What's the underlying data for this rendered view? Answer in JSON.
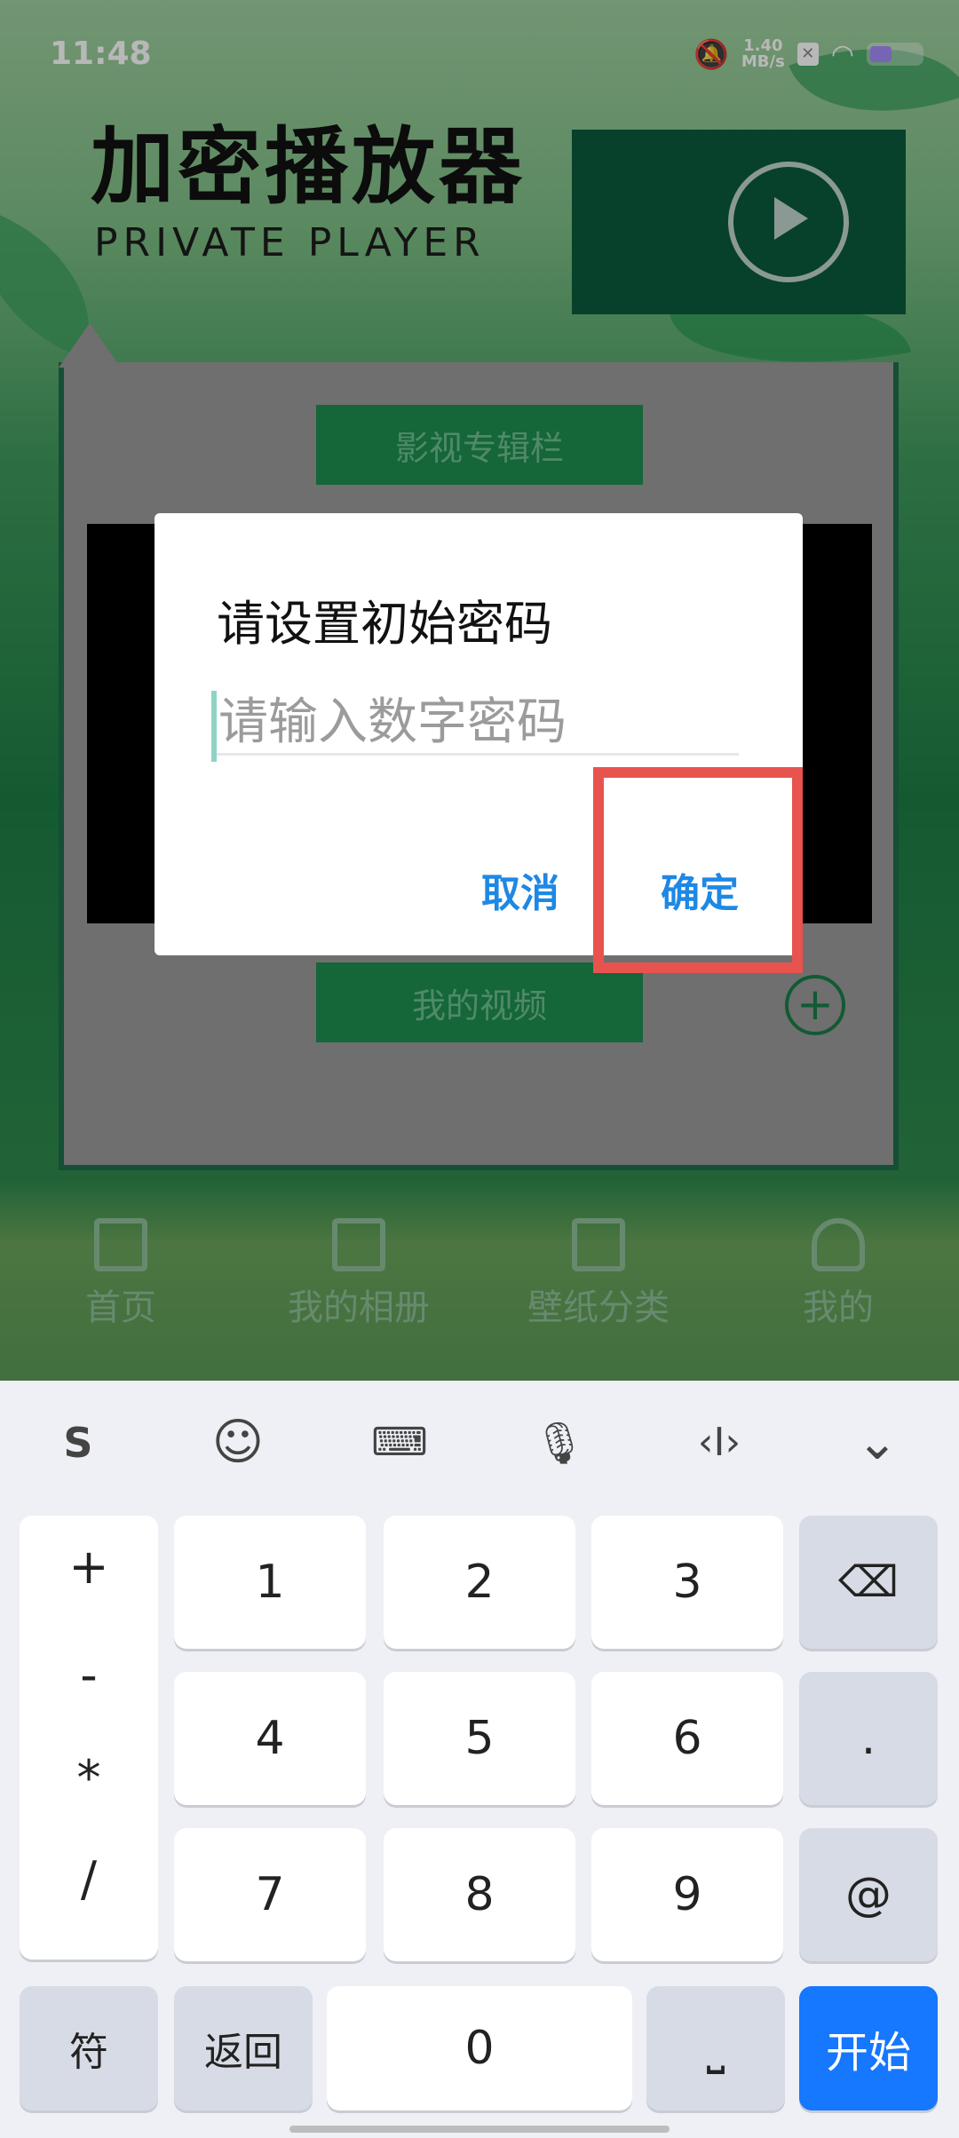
{
  "status_bar": {
    "time": "11:48",
    "net_speed_value": "1.40",
    "net_speed_unit": "MB/s"
  },
  "app": {
    "title": "加密播放器",
    "subtitle": "PRIVATE PLAYER"
  },
  "sections": {
    "album_button": "影视专辑栏",
    "my_videos_button": "我的视频"
  },
  "tabs": [
    {
      "label": "首页"
    },
    {
      "label": "我的相册"
    },
    {
      "label": "壁纸分类"
    },
    {
      "label": "我的"
    }
  ],
  "dialog": {
    "title": "请设置初始密码",
    "input_placeholder": "请输入数字密码",
    "cancel": "取消",
    "confirm": "确定"
  },
  "keyboard": {
    "toolbar_icons": [
      "sogou-icon",
      "emoji-icon",
      "keyboard-icon",
      "microphone-icon",
      "cursor-icon",
      "collapse-icon"
    ],
    "symbols": [
      "+",
      "-",
      "*",
      "/"
    ],
    "digits": [
      "1",
      "2",
      "3",
      "4",
      "5",
      "6",
      "7",
      "8",
      "9",
      "0"
    ],
    "dot": ".",
    "at": "@",
    "symbols_key": "符",
    "back_key": "返回",
    "start_key": "开始"
  },
  "colors": {
    "accent_blue": "#1e88e5",
    "highlight_red": "#e8534e",
    "start_key_blue": "#1677ff",
    "app_green": "#1e8e50"
  }
}
